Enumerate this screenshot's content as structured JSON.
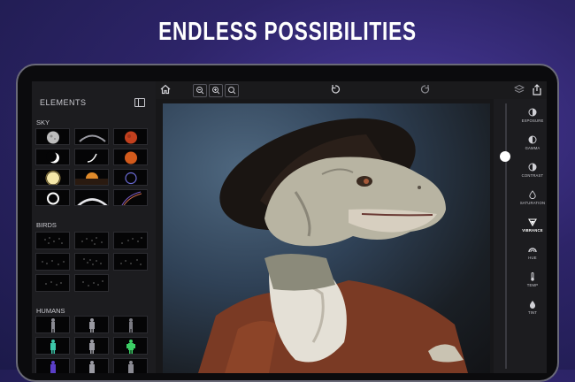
{
  "headline": "ENDLESS POSSIBILITIES",
  "sidebar": {
    "title": "ELEMENTS",
    "sections": {
      "sky": "SKY",
      "birds": "BIRDS",
      "humans": "HUMANS"
    }
  },
  "tools": [
    {
      "label": "EXPOSURE",
      "icon": "exposure-icon",
      "active": false
    },
    {
      "label": "GAMMA",
      "icon": "gamma-icon",
      "active": false
    },
    {
      "label": "CONTRAST",
      "icon": "contrast-icon",
      "active": false
    },
    {
      "label": "SATURATION",
      "icon": "saturation-icon",
      "active": false
    },
    {
      "label": "VIBRANCE",
      "icon": "vibrance-icon",
      "active": true
    },
    {
      "label": "HUE",
      "icon": "hue-icon",
      "active": false
    },
    {
      "label": "TEMP",
      "icon": "temp-icon",
      "active": false
    },
    {
      "label": "TINT",
      "icon": "tint-icon",
      "active": false
    }
  ],
  "slider_level": 0.2
}
